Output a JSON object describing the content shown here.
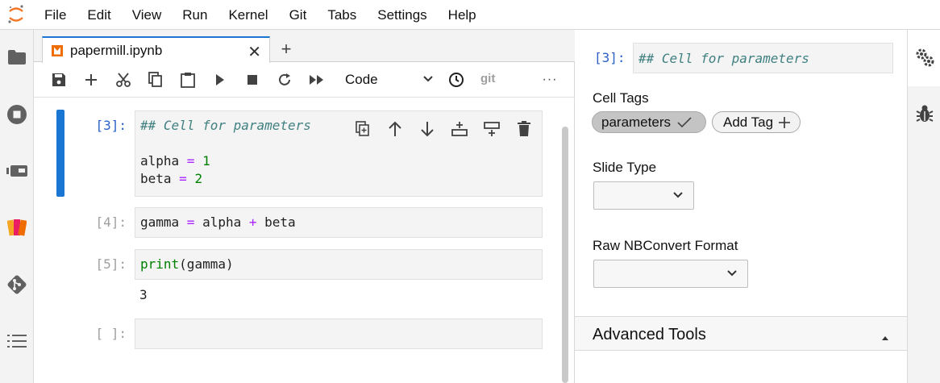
{
  "menubar": {
    "items": [
      "File",
      "Edit",
      "View",
      "Run",
      "Kernel",
      "Git",
      "Tabs",
      "Settings",
      "Help"
    ]
  },
  "tabs": {
    "active_label": "papermill.ipynb",
    "close_glyph": "✕",
    "new_tab_glyph": "+"
  },
  "toolbar": {
    "cell_type": "Code",
    "git_label": "git",
    "more_glyph": "···"
  },
  "cells": [
    {
      "prompt": "[3]:",
      "lines": [
        "## Cell for parameters",
        "",
        "alpha = 1",
        "beta = 2"
      ]
    },
    {
      "prompt": "[4]:",
      "lines": [
        "gamma = alpha + beta"
      ]
    },
    {
      "prompt": "[5]:",
      "lines": [
        "print(gamma)"
      ],
      "output": "3"
    },
    {
      "prompt": "[ ]:",
      "lines": [
        ""
      ]
    }
  ],
  "inspector": {
    "prompt": "[3]:",
    "cell_preview": "## Cell for parameters",
    "cell_tags_label": "Cell Tags",
    "tags": [
      "parameters"
    ],
    "add_tag_label": "Add Tag",
    "slide_type_label": "Slide Type",
    "slide_type_value": "",
    "raw_format_label": "Raw NBConvert Format",
    "raw_format_value": "",
    "advanced_label": "Advanced Tools"
  },
  "icons": {
    "left_sidebar": [
      "folder-icon",
      "running-icon",
      "commands-icon",
      "extension-icon",
      "git-icon",
      "toc-icon"
    ],
    "right_sidebar": [
      "property-inspector-icon",
      "debugger-icon"
    ]
  },
  "colors": {
    "accent": "#1976d2",
    "prompt_active": "#2b61c7",
    "comment": "#408080",
    "operator": "#aa22ff",
    "number": "#008000"
  }
}
